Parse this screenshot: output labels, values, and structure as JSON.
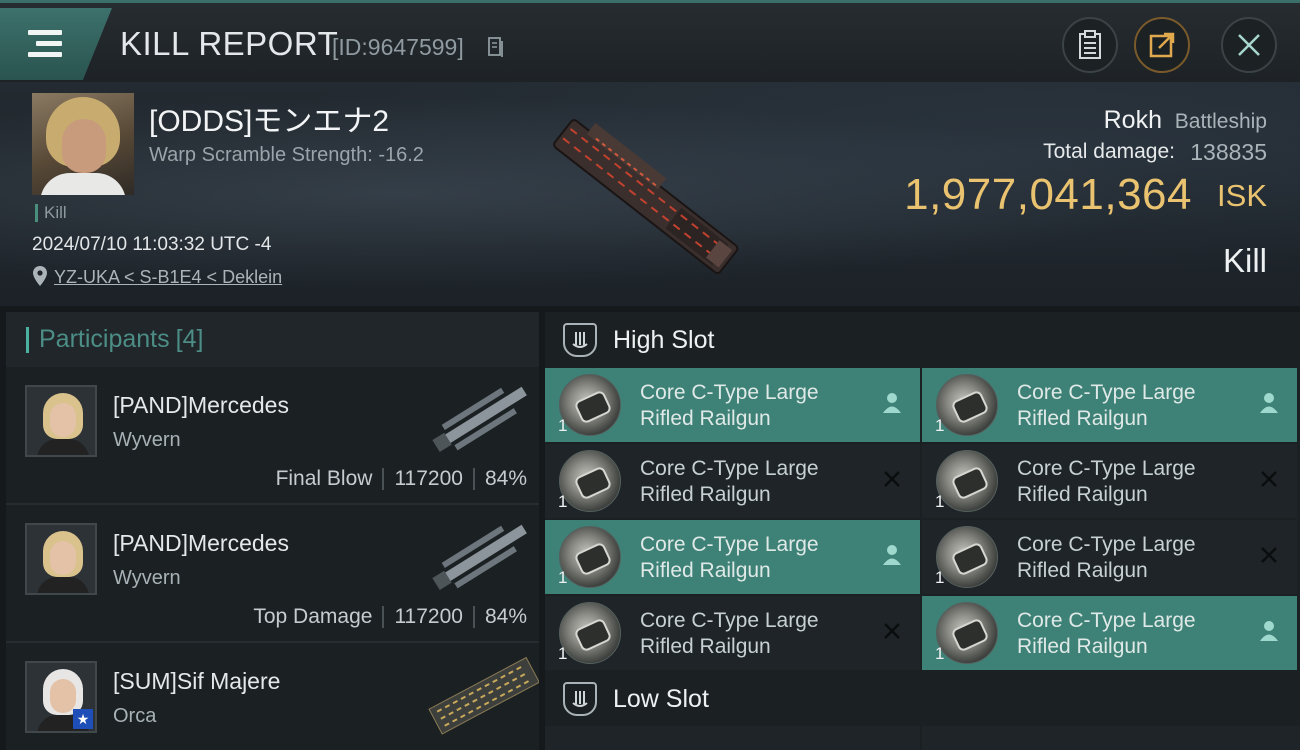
{
  "header": {
    "title": "KILL REPORT",
    "id_text": "[ID:9647599]"
  },
  "victim": {
    "name": "[ODDS]モンエナ2",
    "warp_scramble": "Warp Scramble Strength: -16.2",
    "kill_tag": "Kill",
    "datetime": "2024/07/10 11:03:32 UTC -4",
    "location": "YZ-UKA < S-B1E4 < Deklein",
    "ship_name": "Rokh",
    "ship_class": "Battleship",
    "total_damage_label": "Total damage:",
    "total_damage": "138835",
    "isk_value": "1,977,041,364",
    "isk_unit": "ISK",
    "result": "Kill"
  },
  "participants": {
    "title": "Participants",
    "count": "[4]",
    "rows": [
      {
        "name": "[PAND]Mercedes",
        "ship": "Wyvern",
        "role": "Final Blow",
        "damage": "117200",
        "percent": "84%"
      },
      {
        "name": "[PAND]Mercedes",
        "ship": "Wyvern",
        "role": "Top Damage",
        "damage": "117200",
        "percent": "84%"
      },
      {
        "name": "[SUM]Sif Majere",
        "ship": "Orca",
        "role": "",
        "damage": "",
        "percent": ""
      }
    ]
  },
  "fitting": {
    "high_slot_label": "High Slot",
    "low_slot_label": "Low Slot",
    "modules": [
      {
        "line1": "Core C-Type Large",
        "line2": "Rifled Railgun",
        "qty": "1",
        "status": "dropped",
        "icon": "person-icon"
      },
      {
        "line1": "Core C-Type Large",
        "line2": "Rifled Railgun",
        "qty": "1",
        "status": "dropped",
        "icon": "person-icon"
      },
      {
        "line1": "Core C-Type Large",
        "line2": "Rifled Railgun",
        "qty": "1",
        "status": "destroyed",
        "icon": "x-icon"
      },
      {
        "line1": "Core C-Type Large",
        "line2": "Rifled Railgun",
        "qty": "1",
        "status": "destroyed",
        "icon": "x-icon"
      },
      {
        "line1": "Core C-Type Large",
        "line2": "Rifled Railgun",
        "qty": "1",
        "status": "dropped",
        "icon": "person-icon"
      },
      {
        "line1": "Core C-Type Large",
        "line2": "Rifled Railgun",
        "qty": "1",
        "status": "destroyed",
        "icon": "x-icon"
      },
      {
        "line1": "Core C-Type Large",
        "line2": "Rifled Railgun",
        "qty": "1",
        "status": "destroyed",
        "icon": "x-icon"
      },
      {
        "line1": "Core C-Type Large",
        "line2": "Rifled Railgun",
        "qty": "1",
        "status": "dropped",
        "icon": "person-icon"
      }
    ]
  },
  "colors": {
    "accent_teal": "#3e8176",
    "isk_gold": "#e9c36f",
    "participants_title": "#4c8d86"
  }
}
